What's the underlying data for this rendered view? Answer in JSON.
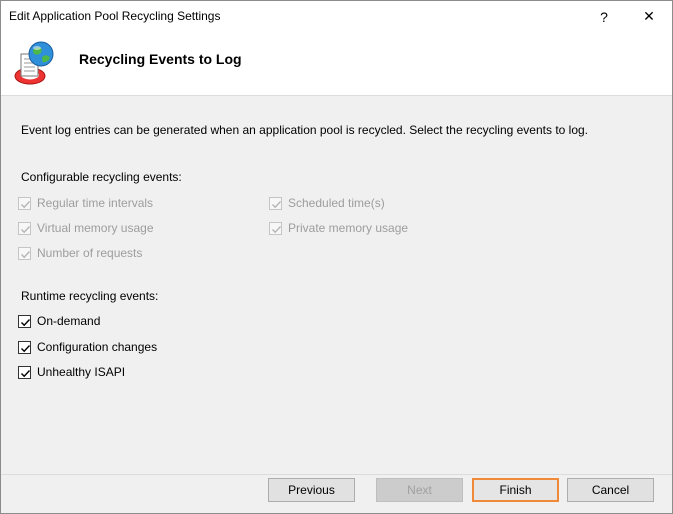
{
  "window": {
    "title": "Edit Application Pool Recycling Settings",
    "help_glyph": "?",
    "close_glyph": "✕"
  },
  "header": {
    "title": "Recycling Events to Log",
    "icon": "app-pool-recycle-icon"
  },
  "main": {
    "description": "Event log entries can be generated when an application pool is recycled. Select the recycling events to log.",
    "configurable_label": "Configurable recycling events:",
    "configurable_events": [
      {
        "label": "Regular time intervals",
        "checked": true,
        "enabled": false
      },
      {
        "label": "Scheduled time(s)",
        "checked": true,
        "enabled": false
      },
      {
        "label": "Virtual memory usage",
        "checked": true,
        "enabled": false
      },
      {
        "label": "Private memory usage",
        "checked": true,
        "enabled": false
      },
      {
        "label": "Number of requests",
        "checked": true,
        "enabled": false
      }
    ],
    "runtime_label": "Runtime recycling events:",
    "runtime_events": [
      {
        "label": "On-demand",
        "checked": true,
        "enabled": true
      },
      {
        "label": "Configuration changes",
        "checked": true,
        "enabled": true
      },
      {
        "label": "Unhealthy ISAPI",
        "checked": true,
        "enabled": true
      }
    ]
  },
  "footer": {
    "previous_label": "Previous",
    "next_label": "Next",
    "finish_label": "Finish",
    "cancel_label": "Cancel"
  },
  "colors": {
    "focus_accent": "#f08a38",
    "disabled_text": "#9d9d9d"
  }
}
